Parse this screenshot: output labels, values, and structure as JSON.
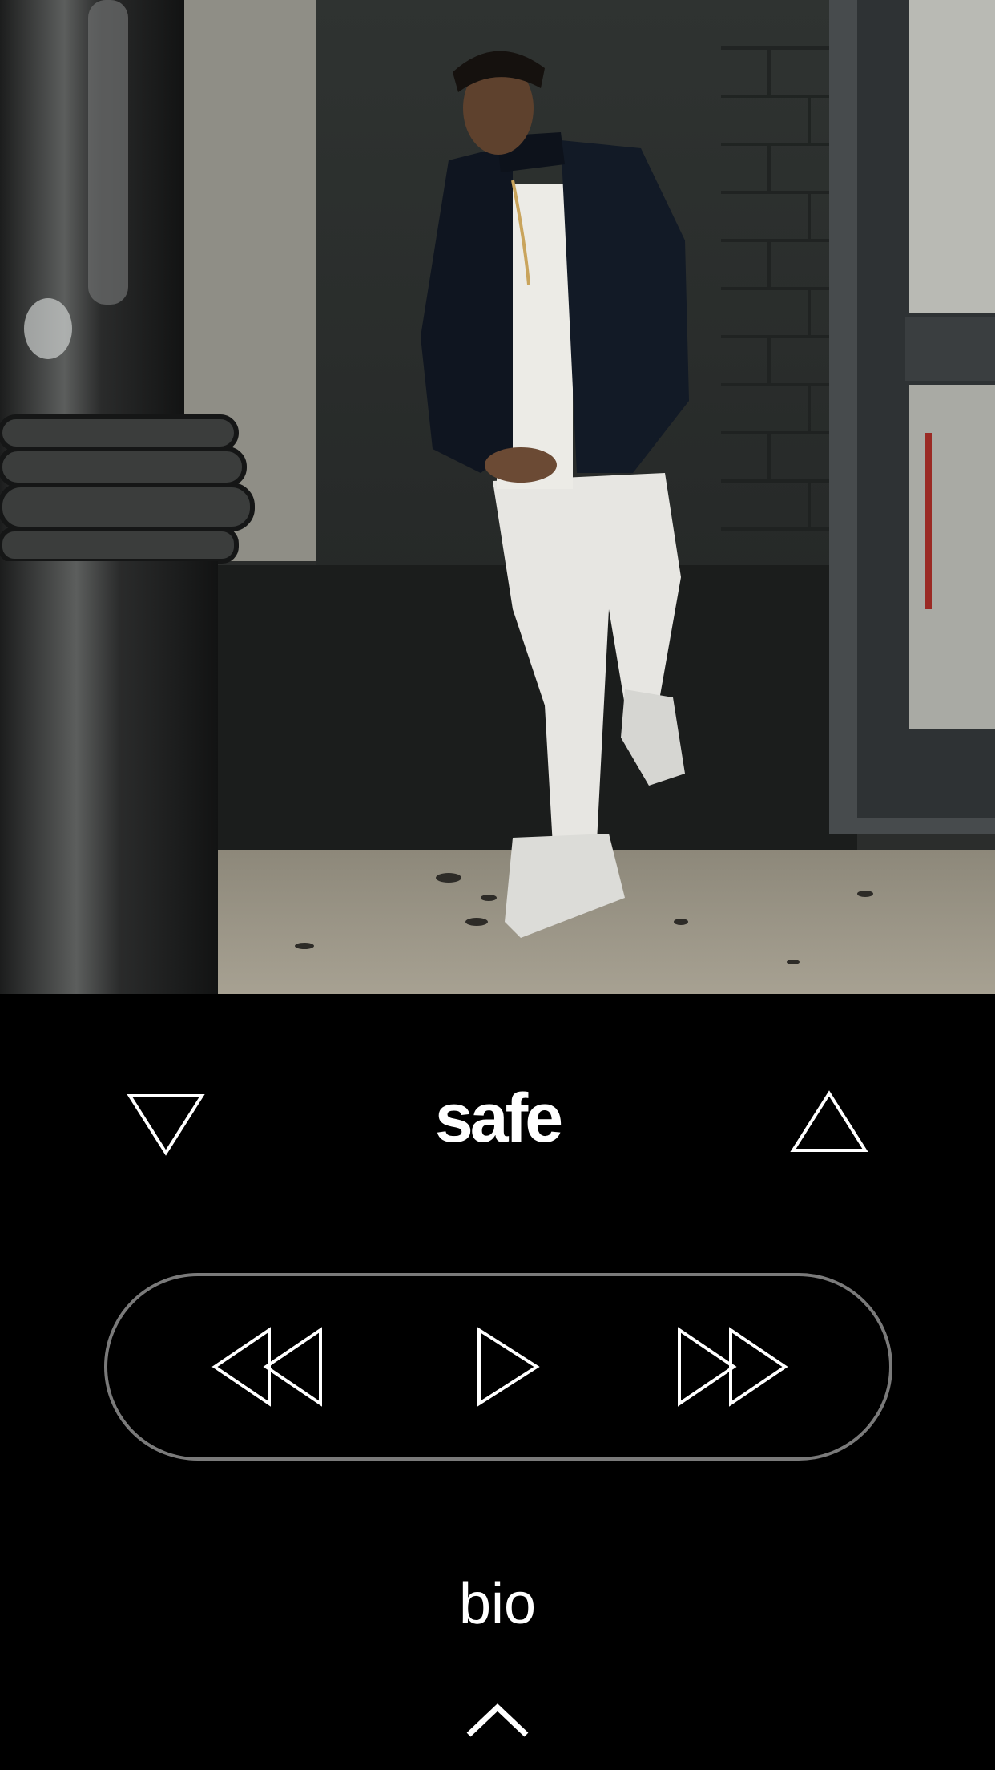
{
  "player": {
    "track_title": "safe",
    "prev_track_icon": "triangle-down-icon",
    "next_track_icon": "triangle-up-icon",
    "transport": {
      "rewind_icon": "rewind-icon",
      "play_icon": "play-icon",
      "forward_icon": "fast-forward-icon"
    }
  },
  "footer": {
    "bio_label": "bio",
    "expand_icon": "chevron-up-icon"
  },
  "colors": {
    "background": "#000000",
    "foreground": "#ffffff",
    "transport_border": "#7a7a7a"
  }
}
